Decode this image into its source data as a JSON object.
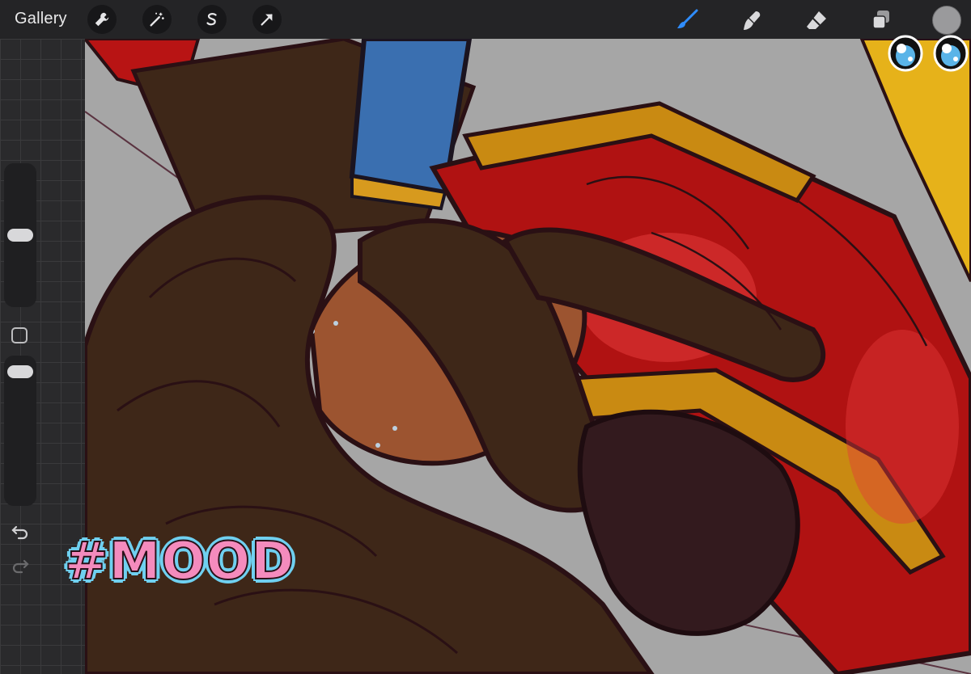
{
  "topbar": {
    "gallery_label": "Gallery",
    "left_tools": [
      {
        "icon": "wrench-icon",
        "name": "actions"
      },
      {
        "icon": "magic-wand-icon",
        "name": "adjustments"
      },
      {
        "icon": "selection-s-icon",
        "name": "selection"
      },
      {
        "icon": "transform-arrow-icon",
        "name": "transform"
      }
    ],
    "right_tools": [
      {
        "icon": "brush-icon",
        "name": "paint",
        "active": true
      },
      {
        "icon": "smudge-icon",
        "name": "smudge"
      },
      {
        "icon": "eraser-icon",
        "name": "erase"
      },
      {
        "icon": "layers-icon",
        "name": "layers"
      }
    ],
    "active_color": "#9a9a9c",
    "accent": "#2f8dff"
  },
  "sidebar": {
    "brush_size_level": 0.5,
    "opacity_level": 0.95
  },
  "overlay": {
    "sticker_text": "#MOOD"
  },
  "colors": {
    "hair": "#3e2718",
    "outline": "#2a1014",
    "skin": "#9c5430",
    "red": "#c41818",
    "gold": "#c98a12",
    "blue": "#3a6fb0"
  }
}
